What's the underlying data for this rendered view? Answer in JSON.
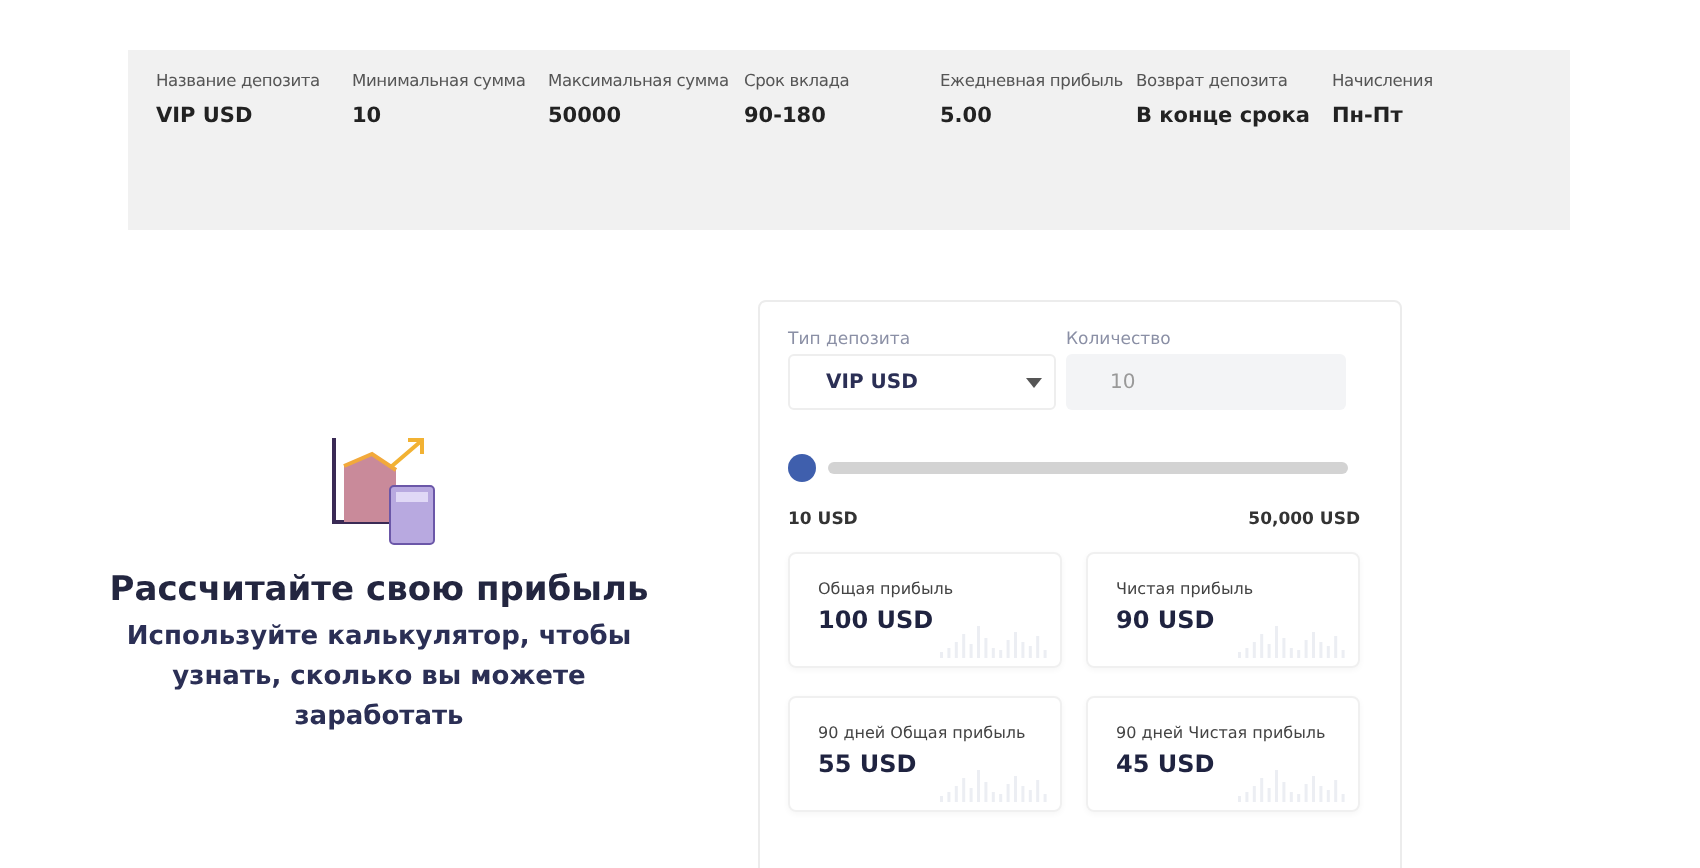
{
  "deposit_info": {
    "columns": [
      {
        "label": "Название депозита",
        "value": "VIP USD"
      },
      {
        "label": "Минимальная сумма",
        "value": "10"
      },
      {
        "label": "Максимальная сумма",
        "value": "50000"
      },
      {
        "label": "Срок вклада",
        "value": "90-180"
      },
      {
        "label": "Ежедневная прибыль",
        "value": "5.00"
      },
      {
        "label": "Возврат депозита",
        "value": "В конце срока"
      },
      {
        "label": "Начисления",
        "value": "Пн-Пт"
      }
    ]
  },
  "promo": {
    "title": "Рассчитайте свою прибыль",
    "text": "Используйте калькулятор, чтобы узнать, сколько вы можете заработать"
  },
  "calculator": {
    "type_field": {
      "label": "Тип депозита",
      "value": "VIP USD"
    },
    "amount_field": {
      "label": "Количество",
      "placeholder": "10"
    },
    "slider": {
      "level": 0,
      "min_label": "10 USD",
      "max_label": "50,000 USD"
    },
    "results": [
      {
        "label": "Общая прибыль",
        "value": "100 USD"
      },
      {
        "label": "Чистая прибыль",
        "value": "90 USD"
      },
      {
        "label": "90 дней Общая прибыль",
        "value": "55 USD"
      },
      {
        "label": "90 дней Чистая прибыль",
        "value": "45 USD"
      }
    ]
  }
}
